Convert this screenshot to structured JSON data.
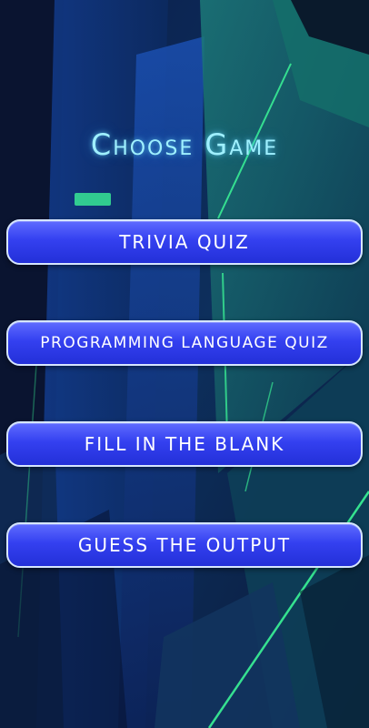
{
  "screen": {
    "title": "Choose Game",
    "accent_color": "#9ff0ff",
    "button_color": "#3440f0"
  },
  "buttons": [
    {
      "label": "TRIVIA QUIZ"
    },
    {
      "label": "PROGRAMMING LANGUAGE QUIZ"
    },
    {
      "label": "FILL IN THE BLANK"
    },
    {
      "label": "GUESS THE OUTPUT"
    }
  ]
}
